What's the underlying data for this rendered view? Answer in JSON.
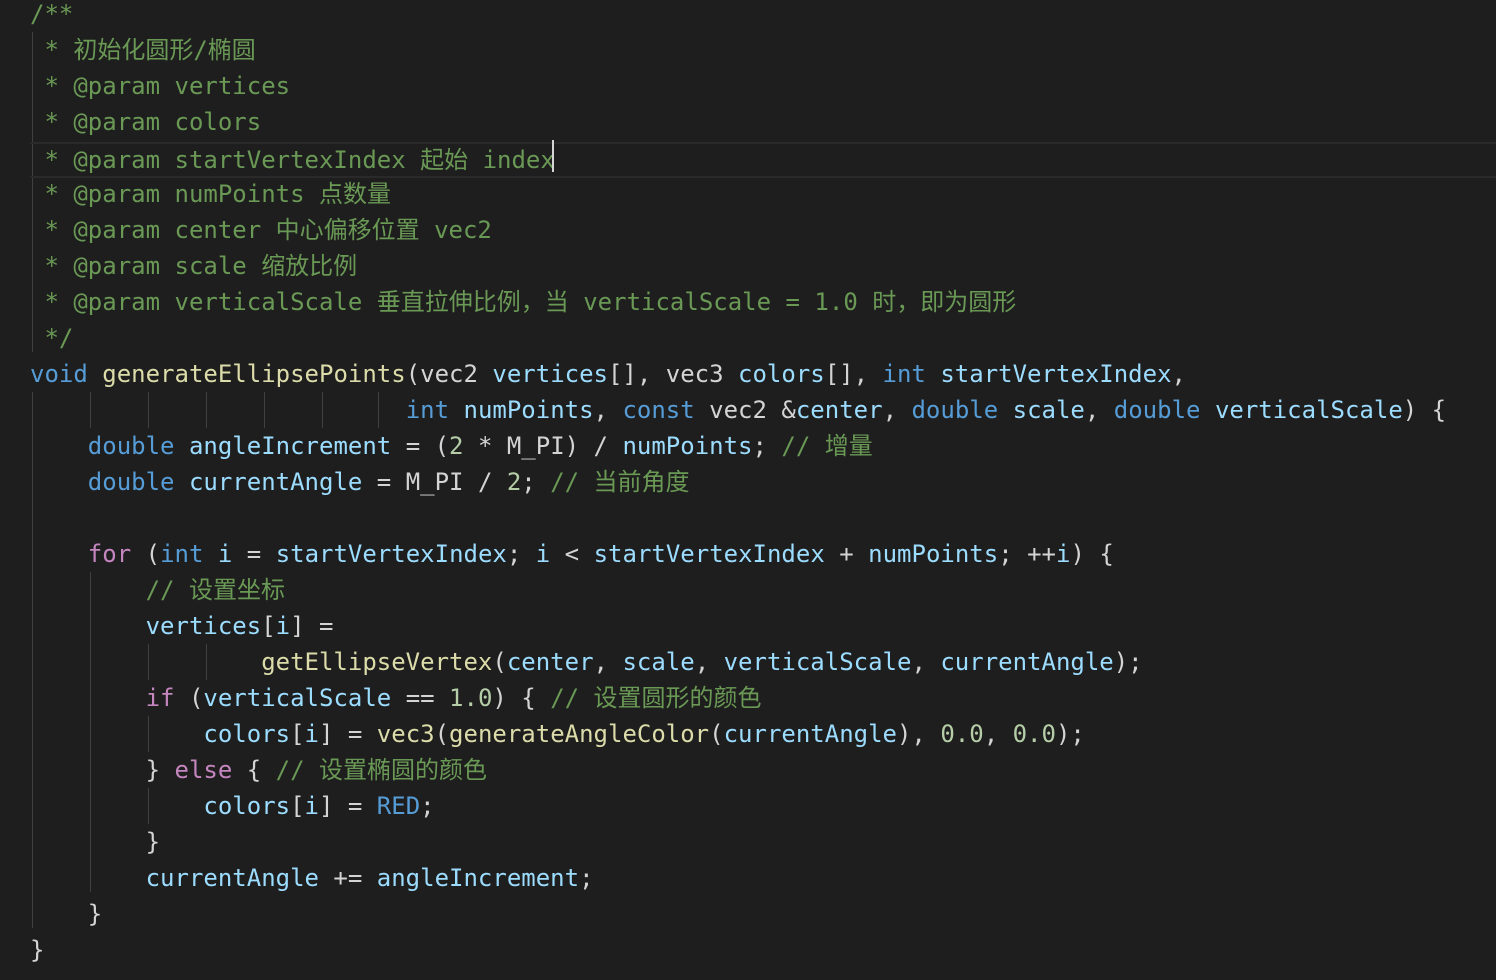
{
  "code": {
    "lines": [
      [
        {
          "t": "/**",
          "c": "c"
        }
      ],
      [
        {
          "t": " * 初始化圆形/椭圆",
          "c": "c"
        }
      ],
      [
        {
          "t": " * @param vertices",
          "c": "c"
        }
      ],
      [
        {
          "t": " * @param colors",
          "c": "c"
        }
      ],
      [
        {
          "t": " * @param startVertexIndex 起始 index",
          "c": "c"
        }
      ],
      [
        {
          "t": " * @param numPoints 点数量",
          "c": "c"
        }
      ],
      [
        {
          "t": " * @param center 中心偏移位置 vec2",
          "c": "c"
        }
      ],
      [
        {
          "t": " * @param scale 缩放比例",
          "c": "c"
        }
      ],
      [
        {
          "t": " * @param verticalScale 垂直拉伸比例，当 verticalScale = 1.0 时，即为圆形",
          "c": "c"
        }
      ],
      [
        {
          "t": " */",
          "c": "c"
        }
      ],
      [
        {
          "t": "void",
          "c": "k"
        },
        {
          "t": " ",
          "c": "t"
        },
        {
          "t": "generateEllipsePoints",
          "c": "f"
        },
        {
          "t": "(vec2 ",
          "c": "t"
        },
        {
          "t": "vertices",
          "c": "v"
        },
        {
          "t": "[], vec3 ",
          "c": "t"
        },
        {
          "t": "colors",
          "c": "v"
        },
        {
          "t": "[], ",
          "c": "t"
        },
        {
          "t": "int",
          "c": "k"
        },
        {
          "t": " ",
          "c": "t"
        },
        {
          "t": "startVertexIndex",
          "c": "v"
        },
        {
          "t": ",",
          "c": "t"
        }
      ],
      [
        {
          "t": "                          ",
          "c": "t"
        },
        {
          "t": "int",
          "c": "k"
        },
        {
          "t": " ",
          "c": "t"
        },
        {
          "t": "numPoints",
          "c": "v"
        },
        {
          "t": ", ",
          "c": "t"
        },
        {
          "t": "const",
          "c": "k"
        },
        {
          "t": " vec2 &",
          "c": "t"
        },
        {
          "t": "center",
          "c": "v"
        },
        {
          "t": ", ",
          "c": "t"
        },
        {
          "t": "double",
          "c": "k"
        },
        {
          "t": " ",
          "c": "t"
        },
        {
          "t": "scale",
          "c": "v"
        },
        {
          "t": ", ",
          "c": "t"
        },
        {
          "t": "double",
          "c": "k"
        },
        {
          "t": " ",
          "c": "t"
        },
        {
          "t": "verticalScale",
          "c": "v"
        },
        {
          "t": ") {",
          "c": "t"
        }
      ],
      [
        {
          "t": "    ",
          "c": "t"
        },
        {
          "t": "double",
          "c": "k"
        },
        {
          "t": " ",
          "c": "t"
        },
        {
          "t": "angleIncrement",
          "c": "v"
        },
        {
          "t": " = (",
          "c": "t"
        },
        {
          "t": "2",
          "c": "n"
        },
        {
          "t": " * M_PI) / ",
          "c": "t"
        },
        {
          "t": "numPoints",
          "c": "v"
        },
        {
          "t": "; ",
          "c": "t"
        },
        {
          "t": "// 增量",
          "c": "c"
        }
      ],
      [
        {
          "t": "    ",
          "c": "t"
        },
        {
          "t": "double",
          "c": "k"
        },
        {
          "t": " ",
          "c": "t"
        },
        {
          "t": "currentAngle",
          "c": "v"
        },
        {
          "t": " = M_PI / ",
          "c": "t"
        },
        {
          "t": "2",
          "c": "n"
        },
        {
          "t": "; ",
          "c": "t"
        },
        {
          "t": "// 当前角度",
          "c": "c"
        }
      ],
      [
        {
          "t": "",
          "c": "t"
        }
      ],
      [
        {
          "t": "    ",
          "c": "t"
        },
        {
          "t": "for",
          "c": "p"
        },
        {
          "t": " (",
          "c": "t"
        },
        {
          "t": "int",
          "c": "k"
        },
        {
          "t": " ",
          "c": "t"
        },
        {
          "t": "i",
          "c": "v"
        },
        {
          "t": " = ",
          "c": "t"
        },
        {
          "t": "startVertexIndex",
          "c": "v"
        },
        {
          "t": "; ",
          "c": "t"
        },
        {
          "t": "i",
          "c": "v"
        },
        {
          "t": " < ",
          "c": "t"
        },
        {
          "t": "startVertexIndex",
          "c": "v"
        },
        {
          "t": " + ",
          "c": "t"
        },
        {
          "t": "numPoints",
          "c": "v"
        },
        {
          "t": "; ++",
          "c": "t"
        },
        {
          "t": "i",
          "c": "v"
        },
        {
          "t": ") {",
          "c": "t"
        }
      ],
      [
        {
          "t": "        ",
          "c": "t"
        },
        {
          "t": "// 设置坐标",
          "c": "c"
        }
      ],
      [
        {
          "t": "        ",
          "c": "t"
        },
        {
          "t": "vertices",
          "c": "v"
        },
        {
          "t": "[",
          "c": "t"
        },
        {
          "t": "i",
          "c": "v"
        },
        {
          "t": "] =",
          "c": "t"
        }
      ],
      [
        {
          "t": "                ",
          "c": "t"
        },
        {
          "t": "getEllipseVertex",
          "c": "f"
        },
        {
          "t": "(",
          "c": "t"
        },
        {
          "t": "center",
          "c": "v"
        },
        {
          "t": ", ",
          "c": "t"
        },
        {
          "t": "scale",
          "c": "v"
        },
        {
          "t": ", ",
          "c": "t"
        },
        {
          "t": "verticalScale",
          "c": "v"
        },
        {
          "t": ", ",
          "c": "t"
        },
        {
          "t": "currentAngle",
          "c": "v"
        },
        {
          "t": ");",
          "c": "t"
        }
      ],
      [
        {
          "t": "        ",
          "c": "t"
        },
        {
          "t": "if",
          "c": "p"
        },
        {
          "t": " (",
          "c": "t"
        },
        {
          "t": "verticalScale",
          "c": "v"
        },
        {
          "t": " == ",
          "c": "t"
        },
        {
          "t": "1.0",
          "c": "n"
        },
        {
          "t": ") { ",
          "c": "t"
        },
        {
          "t": "// 设置圆形的颜色",
          "c": "c"
        }
      ],
      [
        {
          "t": "            ",
          "c": "t"
        },
        {
          "t": "colors",
          "c": "v"
        },
        {
          "t": "[",
          "c": "t"
        },
        {
          "t": "i",
          "c": "v"
        },
        {
          "t": "] = ",
          "c": "t"
        },
        {
          "t": "vec3",
          "c": "f"
        },
        {
          "t": "(",
          "c": "t"
        },
        {
          "t": "generateAngleColor",
          "c": "f"
        },
        {
          "t": "(",
          "c": "t"
        },
        {
          "t": "currentAngle",
          "c": "v"
        },
        {
          "t": "), ",
          "c": "t"
        },
        {
          "t": "0.0",
          "c": "n"
        },
        {
          "t": ", ",
          "c": "t"
        },
        {
          "t": "0.0",
          "c": "n"
        },
        {
          "t": ");",
          "c": "t"
        }
      ],
      [
        {
          "t": "        } ",
          "c": "t"
        },
        {
          "t": "else",
          "c": "p"
        },
        {
          "t": " { ",
          "c": "t"
        },
        {
          "t": "// 设置椭圆的颜色",
          "c": "c"
        }
      ],
      [
        {
          "t": "            ",
          "c": "t"
        },
        {
          "t": "colors",
          "c": "v"
        },
        {
          "t": "[",
          "c": "t"
        },
        {
          "t": "i",
          "c": "v"
        },
        {
          "t": "] = ",
          "c": "t"
        },
        {
          "t": "RED",
          "c": "k"
        },
        {
          "t": ";",
          "c": "t"
        }
      ],
      [
        {
          "t": "        }",
          "c": "t"
        }
      ],
      [
        {
          "t": "        ",
          "c": "t"
        },
        {
          "t": "currentAngle",
          "c": "v"
        },
        {
          "t": " += ",
          "c": "t"
        },
        {
          "t": "angleIncrement",
          "c": "v"
        },
        {
          "t": ";",
          "c": "t"
        }
      ],
      [
        {
          "t": "    }",
          "c": "t"
        }
      ],
      [
        {
          "t": "}",
          "c": "t"
        }
      ]
    ],
    "current_line": 4
  },
  "colors": {
    "background": "#1e1e1e",
    "comment": "#6a9955",
    "keyword": "#569cd6",
    "function": "#dcdcaa",
    "variable": "#9cdcfe",
    "number": "#b5cea8",
    "control": "#c586c0",
    "plain": "#d4d4d4"
  }
}
